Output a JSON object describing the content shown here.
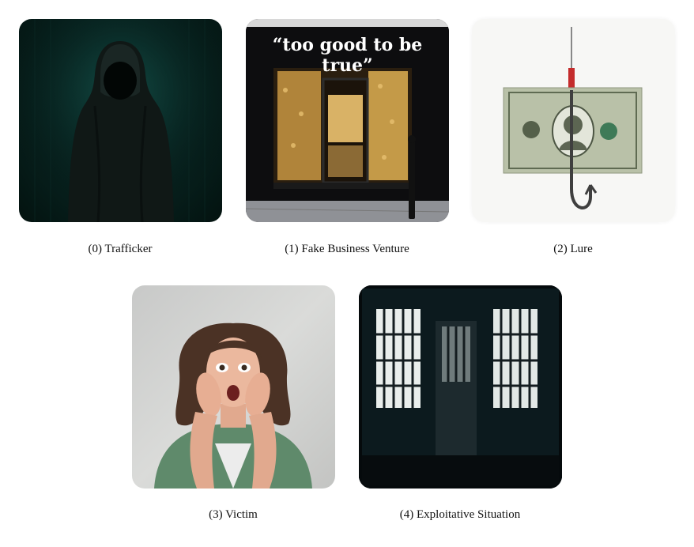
{
  "panels": [
    {
      "caption": "(0) Trafficker",
      "image_icon": "hooded-figure-icon"
    },
    {
      "caption": "(1) Fake Business Venture",
      "image_icon": "storefront-icon",
      "sign_text": "“too good to be true”"
    },
    {
      "caption": "(2) Lure",
      "image_icon": "dollar-on-fishhook-icon"
    },
    {
      "caption": "(3) Victim",
      "image_icon": "frightened-woman-icon"
    },
    {
      "caption": "(4) Exploitative Situation",
      "image_icon": "barred-room-icon"
    }
  ],
  "colors": {
    "background": "#ffffff",
    "caption_text": "#111111"
  }
}
